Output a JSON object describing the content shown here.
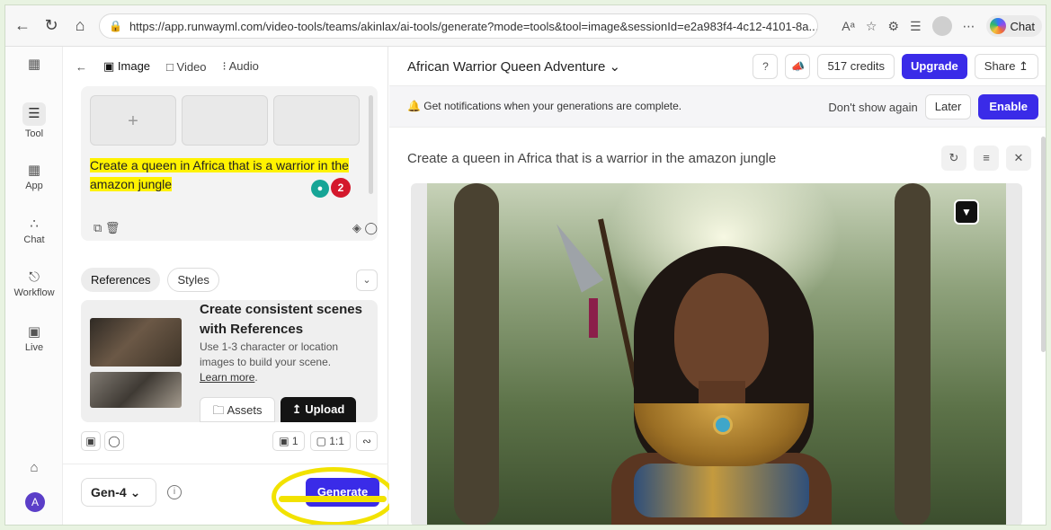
{
  "browser": {
    "url": "https://app.runwayml.com/video-tools/teams/akinlax/ai-tools/generate?mode=tools&tool=image&sessionId=e2a983f4-4c12-4101-8a...",
    "reader_label": "Aᵃ",
    "chat_label": "Chat"
  },
  "rail": {
    "items": [
      {
        "label": "Tool"
      },
      {
        "label": "App"
      },
      {
        "label": "Chat"
      },
      {
        "label": "Workflow"
      },
      {
        "label": "Live"
      }
    ],
    "avatar_letter": "A"
  },
  "left": {
    "modes": [
      "Image",
      "Video",
      "Audio"
    ],
    "prompt": {
      "add_symbol": "+",
      "line1": "Create a queen in Africa that is a warrior in the",
      "line2": "amazon jungle",
      "badge_count": "2"
    },
    "ref_tabs": [
      "References",
      "Styles"
    ],
    "ref_card": {
      "title": "Create consistent scenes with References",
      "body": "Use 1-3 character or location images to build your scene.",
      "learn_more": "Learn more",
      "assets_label": "Assets",
      "upload_label": "Upload"
    },
    "options": {
      "count": "1",
      "ratio": "1:1"
    },
    "model": "Gen-4",
    "generate_label": "Generate"
  },
  "main": {
    "project_title": "African Warrior Queen Adventure",
    "credits": "517 credits",
    "upgrade_label": "Upgrade",
    "share_label": "Share",
    "notification": {
      "text": "Get notifications when your generations are complete.",
      "dont_show": "Don't show again",
      "later": "Later",
      "enable": "Enable"
    },
    "generation_prompt": "Create a queen in Africa that is a warrior in the amazon jungle"
  },
  "colors": {
    "accent": "#3a2be8",
    "highlight": "#fff200",
    "annotation": "#f2e200"
  },
  "icons": [
    "back-icon",
    "refresh-icon",
    "home-icon",
    "lock-icon",
    "star-icon",
    "extensions-icon",
    "favorites-icon",
    "profile-icon",
    "more-icon",
    "copilot-icon",
    "chevron-down-icon",
    "bell-icon",
    "close-icon",
    "dislike-icon",
    "copy-icon",
    "trash-icon",
    "upload-icon",
    "folder-icon",
    "info-icon"
  ]
}
